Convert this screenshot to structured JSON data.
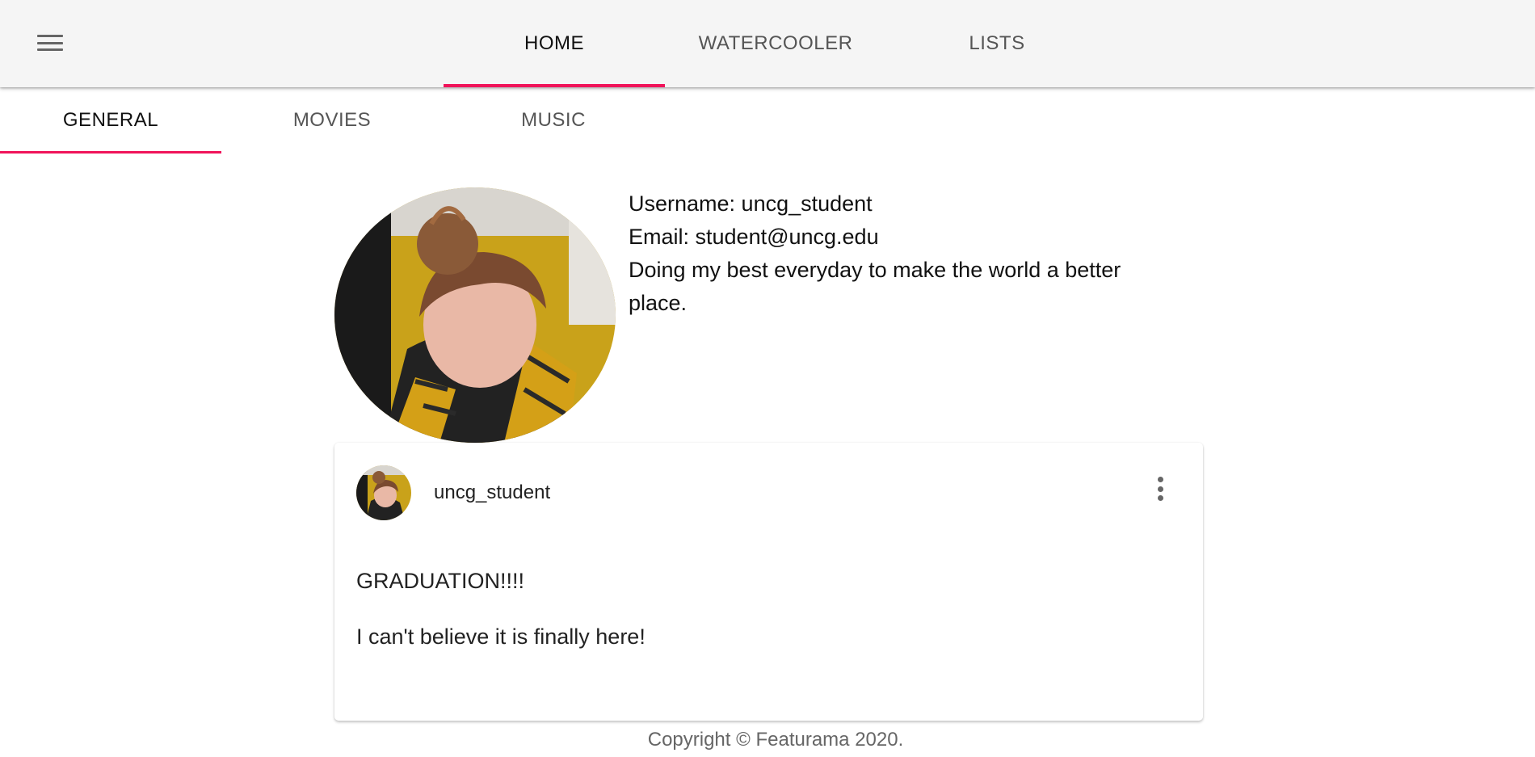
{
  "nav": {
    "menu_icon": "hamburger-menu-icon",
    "tabs": [
      {
        "label": "HOME",
        "active": true
      },
      {
        "label": "WATERCOOLER",
        "active": false
      },
      {
        "label": "LISTS",
        "active": false
      }
    ],
    "accent_color": "#f0145a"
  },
  "sub_nav": {
    "tabs": [
      {
        "label": "GENERAL",
        "active": true
      },
      {
        "label": "MOVIES",
        "active": false
      },
      {
        "label": "MUSIC",
        "active": false
      }
    ]
  },
  "profile": {
    "username_line": "Username: uncg_student",
    "email_line": "Email: student@uncg.edu",
    "bio": "Doing my best everyday to make the world a better place."
  },
  "post": {
    "author": "uncg_student",
    "more_icon": "more-vertical-icon",
    "title": "GRADUATION!!!!",
    "body": "I can't believe it is finally here!"
  },
  "footer": {
    "copyright": "Copyright © Featurama 2020."
  }
}
